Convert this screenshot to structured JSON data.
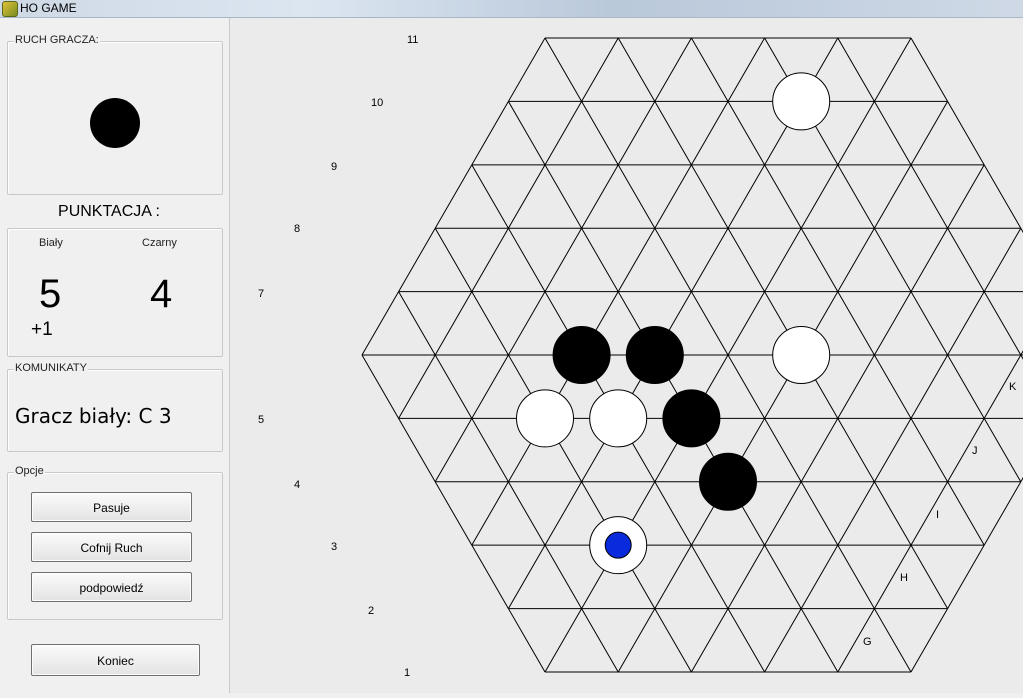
{
  "window": {
    "title": "HO GAME"
  },
  "turn_panel": {
    "legend": "RUCH GRACZA:",
    "current_player": "black"
  },
  "score": {
    "title": "PUNKTACJA :",
    "white_label": "Biały",
    "black_label": "Czarny",
    "white_value": "5",
    "black_value": "4",
    "white_bonus": "+1"
  },
  "messages": {
    "legend": "KOMUNIKATY",
    "text": "Gracz biały: C 3"
  },
  "options": {
    "legend": "Opcje",
    "pass_label": "Pasuje",
    "undo_label": "Cofnij Ruch",
    "hint_label": "podpowiedź"
  },
  "end_label": "Koniec",
  "board": {
    "side": 6,
    "row_labels": [
      "1",
      "2",
      "3",
      "4",
      "5",
      "7",
      "8",
      "9",
      "10",
      "11"
    ],
    "col_labels": [
      "G",
      "H",
      "I",
      "J",
      "K"
    ],
    "stones": [
      {
        "color": "white",
        "row": 10,
        "pos": 5
      },
      {
        "color": "black",
        "row": 6,
        "pos": 4
      },
      {
        "color": "black",
        "row": 6,
        "pos": 5
      },
      {
        "color": "white",
        "row": 6,
        "pos": 7
      },
      {
        "color": "white",
        "row": 5,
        "pos": 3
      },
      {
        "color": "white",
        "row": 5,
        "pos": 4
      },
      {
        "color": "black",
        "row": 5,
        "pos": 5
      },
      {
        "color": "black",
        "row": 4,
        "pos": 5
      },
      {
        "color": "white",
        "row": 3,
        "pos": 3,
        "marker": "blue"
      }
    ],
    "colors": {
      "line": "#000000",
      "white_stone": "#ffffff",
      "black_stone": "#000000",
      "marker": "#0a2bdc"
    }
  }
}
